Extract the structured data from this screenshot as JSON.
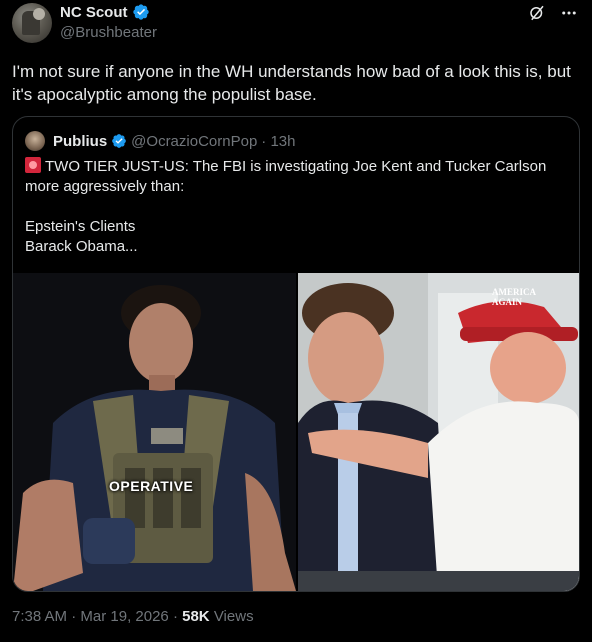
{
  "author": {
    "display_name": "NC Scout",
    "handle": "@Brushbeater"
  },
  "tweet": {
    "text": "I'm not sure if anyone in the WH understands how bad of a look this is, but it's apocalyptic among the populist base."
  },
  "quote": {
    "display_name": "Publius",
    "handle": "@OcrazioCornPop",
    "time": "· 13h",
    "text": "TWO TIER JUST-US: The FBI is investigating Joe Kent and Tucker Carlson more aggressively than:\n\nEpstein's Clients\nBarack Obama...",
    "image_left_label": "OPERATIVE",
    "hat_text": "AMERICA\nAGAIN"
  },
  "meta": {
    "time": "7:38 AM",
    "sep1": " · ",
    "date": "Mar 19, 2026",
    "sep2": " · ",
    "views_count": "58K",
    "views_label": " Views"
  },
  "colors": {
    "background": "#000000",
    "text": "#e7e9ea",
    "muted": "#71767b",
    "verified": "#1d9bf0",
    "border": "#2f3336"
  }
}
